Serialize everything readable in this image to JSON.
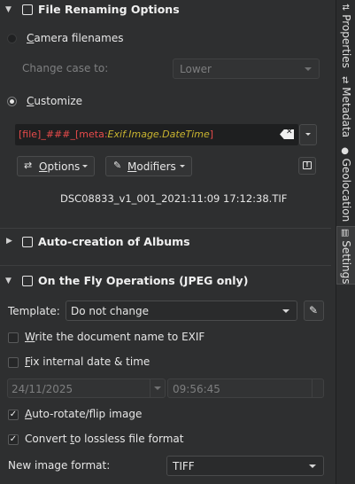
{
  "sections": {
    "file_renaming": {
      "title": "File Renaming Options",
      "camera_label_key": "C",
      "camera_label_rest": "amera filenames",
      "change_case_label": "Change case to:",
      "change_case_value": "Lower",
      "customize_label_key": "C",
      "customize_label_rest": "ustomize",
      "pattern_file": "[file]",
      "pattern_mid": "_###_",
      "pattern_meta_open": "[meta:",
      "pattern_meta_field": "Exif.Image.DateTime",
      "pattern_meta_close": "]",
      "options_key": "O",
      "options_rest": "ptions",
      "modifiers_key": "M",
      "modifiers_rest": "odifiers",
      "preview": "DSC08833_v1_001_2021:11:09 17:12:38.TIF"
    },
    "albums": {
      "title": "Auto-creation of Albums"
    },
    "on_the_fly": {
      "title": "On the Fly Operations (JPEG only)",
      "template_label": "Template:",
      "template_value": "Do not change",
      "write_exif_key": "W",
      "write_exif_rest": "rite the document name to EXIF",
      "fix_date_key": "F",
      "fix_date_rest": "ix internal date & time",
      "date_value": "24/11/2025",
      "time_value": "09:56:45",
      "autorotate_key": "A",
      "autorotate_rest": "uto-rotate/flip image",
      "lossless_pre": "Convert ",
      "lossless_key": "t",
      "lossless_rest": "o lossless file format",
      "format_label": "New image format:",
      "format_value": "TIFF",
      "write_exif_checked": false,
      "fix_date_checked": false,
      "autorotate_checked": true,
      "lossless_checked": true
    }
  },
  "sidebar": {
    "tabs": [
      {
        "label": "Properties",
        "icon": "sliders-icon"
      },
      {
        "label": "Metadata",
        "icon": "metadata-icon"
      },
      {
        "label": "Geolocation",
        "icon": "globe-icon"
      },
      {
        "label": "Settings",
        "icon": "settings-icon"
      }
    ]
  },
  "colors": {
    "background": "#2e2f30",
    "pattern_red": "#e84b4b",
    "pattern_meta_field": "#c9b430",
    "accent_white": "#f0f0f0"
  }
}
